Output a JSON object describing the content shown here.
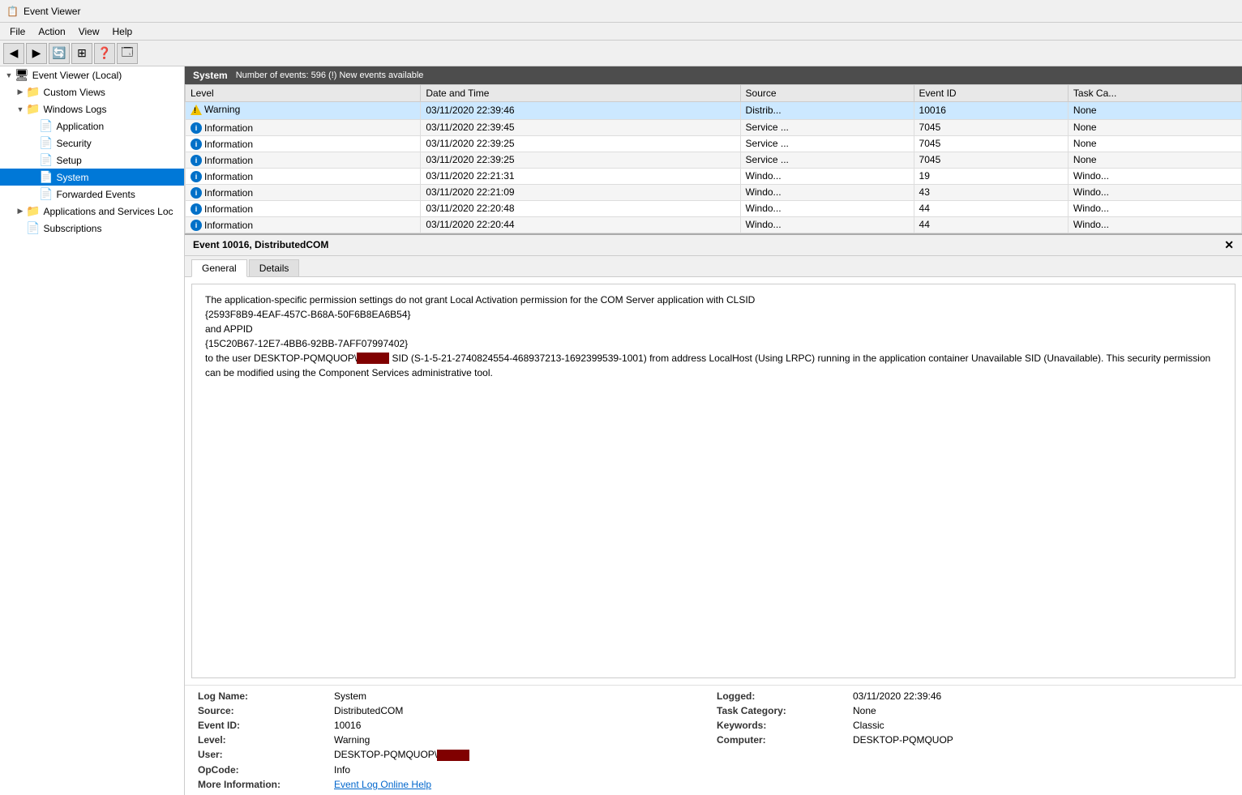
{
  "titleBar": {
    "title": "Event Viewer",
    "icon": "📋"
  },
  "menuBar": {
    "items": [
      "File",
      "Action",
      "View",
      "Help"
    ]
  },
  "toolbar": {
    "buttons": [
      "◀",
      "▶",
      "🔄",
      "⊞",
      "❓",
      "🗔"
    ]
  },
  "sidebar": {
    "items": [
      {
        "id": "event-viewer-local",
        "label": "Event Viewer (Local)",
        "level": 0,
        "expanded": true,
        "icon": "🖥"
      },
      {
        "id": "custom-views",
        "label": "Custom Views",
        "level": 1,
        "expanded": false,
        "icon": "📁"
      },
      {
        "id": "windows-logs",
        "label": "Windows Logs",
        "level": 1,
        "expanded": true,
        "icon": "📁"
      },
      {
        "id": "application",
        "label": "Application",
        "level": 2,
        "expanded": false,
        "icon": "📄"
      },
      {
        "id": "security",
        "label": "Security",
        "level": 2,
        "expanded": false,
        "icon": "📄"
      },
      {
        "id": "setup",
        "label": "Setup",
        "level": 2,
        "expanded": false,
        "icon": "📄"
      },
      {
        "id": "system",
        "label": "System",
        "level": 2,
        "expanded": false,
        "icon": "📄",
        "selected": true
      },
      {
        "id": "forwarded-events",
        "label": "Forwarded Events",
        "level": 2,
        "expanded": false,
        "icon": "📄"
      },
      {
        "id": "apps-services-logs",
        "label": "Applications and Services Loc",
        "level": 1,
        "expanded": false,
        "icon": "📁"
      },
      {
        "id": "subscriptions",
        "label": "Subscriptions",
        "level": 1,
        "expanded": false,
        "icon": "📄"
      }
    ]
  },
  "eventList": {
    "panelTitle": "System",
    "panelSubtitle": "Number of events: 596 (!) New events available",
    "columns": [
      "Level",
      "Date and Time",
      "Source",
      "Event ID",
      "Task Ca..."
    ],
    "rows": [
      {
        "level": "Warning",
        "levelType": "warning",
        "dateTime": "03/11/2020 22:39:46",
        "source": "Distrib...",
        "eventId": "10016",
        "taskCat": "None",
        "selected": true
      },
      {
        "level": "Information",
        "levelType": "info",
        "dateTime": "03/11/2020 22:39:45",
        "source": "Service ...",
        "eventId": "7045",
        "taskCat": "None"
      },
      {
        "level": "Information",
        "levelType": "info",
        "dateTime": "03/11/2020 22:39:25",
        "source": "Service ...",
        "eventId": "7045",
        "taskCat": "None"
      },
      {
        "level": "Information",
        "levelType": "info",
        "dateTime": "03/11/2020 22:39:25",
        "source": "Service ...",
        "eventId": "7045",
        "taskCat": "None"
      },
      {
        "level": "Information",
        "levelType": "info",
        "dateTime": "03/11/2020 22:21:31",
        "source": "Windo...",
        "eventId": "19",
        "taskCat": "Windo..."
      },
      {
        "level": "Information",
        "levelType": "info",
        "dateTime": "03/11/2020 22:21:09",
        "source": "Windo...",
        "eventId": "43",
        "taskCat": "Windo..."
      },
      {
        "level": "Information",
        "levelType": "info",
        "dateTime": "03/11/2020 22:20:48",
        "source": "Windo...",
        "eventId": "44",
        "taskCat": "Windo..."
      },
      {
        "level": "Information",
        "levelType": "info",
        "dateTime": "03/11/2020 22:20:44",
        "source": "Windo...",
        "eventId": "44",
        "taskCat": "Windo..."
      }
    ]
  },
  "detail": {
    "title": "Event 10016, DistributedCOM",
    "tabs": [
      "General",
      "Details"
    ],
    "activeTab": "General",
    "message": "The application-specific permission settings do not grant Local Activation permission for the COM Server application with CLSID\n{2593F8B9-4EAF-457C-B68A-50F6B8EA6B54}\nand APPID\n{15C20B67-12E7-4BB6-92BB-7AFF07997402}\nto the user DESKTOP-PQMQUOP\\[REDACTED] SID (S-1-5-21-2740824554-468937213-1692399539-1001) from address LocalHost (Using LRPC) running in the application container Unavailable SID (Unavailable). This security permission can be modified using the Component Services administrative tool.",
    "fields": {
      "logName": {
        "label": "Log Name:",
        "value": "System"
      },
      "source": {
        "label": "Source:",
        "value": "DistributedCOM"
      },
      "eventId": {
        "label": "Event ID:",
        "value": "10016"
      },
      "level": {
        "label": "Level:",
        "value": "Warning"
      },
      "user": {
        "label": "User:",
        "value": "DESKTOP-PQMQUOP\\"
      },
      "opCode": {
        "label": "OpCode:",
        "value": "Info"
      },
      "moreInfo": {
        "label": "More Information:",
        "value": "Event Log Online Help"
      },
      "logged": {
        "label": "Logged:",
        "value": "03/11/2020 22:39:46"
      },
      "taskCategory": {
        "label": "Task Category:",
        "value": "None"
      },
      "keywords": {
        "label": "Keywords:",
        "value": "Classic"
      },
      "computer": {
        "label": "Computer:",
        "value": "DESKTOP-PQMQUOP"
      }
    }
  }
}
